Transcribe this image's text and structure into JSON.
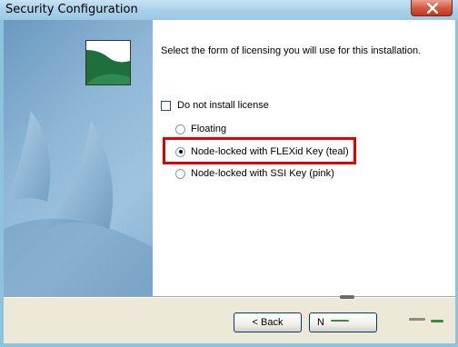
{
  "window": {
    "title": "Security Configuration"
  },
  "content": {
    "instruction": "Select the form of licensing you will use for this installation.",
    "no_license_checkbox": {
      "label": "Do not install license",
      "checked": false
    },
    "license_options": [
      {
        "label": "Floating",
        "selected": false
      },
      {
        "label": "Node-locked with FLEXid Key (teal)",
        "selected": true
      },
      {
        "label": "Node-locked with SSI Key (pink)",
        "selected": false
      }
    ]
  },
  "buttons": {
    "back_label": "< Back",
    "next_label": "N"
  },
  "colors": {
    "highlight": "#e00000",
    "logo_green": "#1f6f3d",
    "panel_blue": "#8fb7d6"
  },
  "icons": {
    "close": "close-icon",
    "logo": "app-logo-icon",
    "sail": "sail-graphic"
  }
}
